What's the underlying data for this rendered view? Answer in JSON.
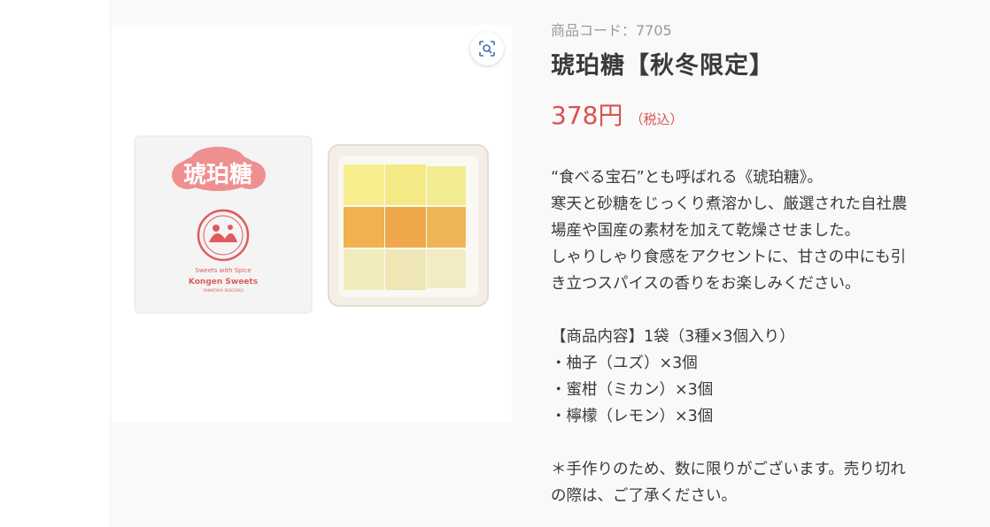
{
  "product": {
    "code": "商品コード：7705",
    "title": "琥珀糖【秋冬限定】",
    "price": "378円",
    "tax_label": "（税込）",
    "description": {
      "intro": [
        "“食べる宝石”とも呼ばれる《琥珀糖》。",
        "寒天と砂糖をじっくり煮溶かし、厳選された自社農",
        "場産や国産の素材を加えて乾燥させました。",
        "しゃりしゃり食感をアクセントに、甘さの中にも引",
        "き立つスパイスの香りをお楽しみください。"
      ],
      "contents": [
        "【商品内容】1袋（3種×3個入り）",
        "・柚子（ユズ）×3個",
        "・蜜柑（ミカン）×3個",
        "・檸檬（レモン）×3個"
      ],
      "notes": [
        "＊手作りのため、数に限りがございます。売り切れ",
        "の際は、ご了承ください。"
      ]
    }
  },
  "gallery": {
    "zoom_icon": "zoom-scan-icon",
    "package_label": "琥珀糖",
    "package_tagline": "Sweets with Spice",
    "package_brand": "Kongen Sweets",
    "package_sub": "YAMATAYA ISOGORO",
    "accent_color": "#d9534f"
  }
}
